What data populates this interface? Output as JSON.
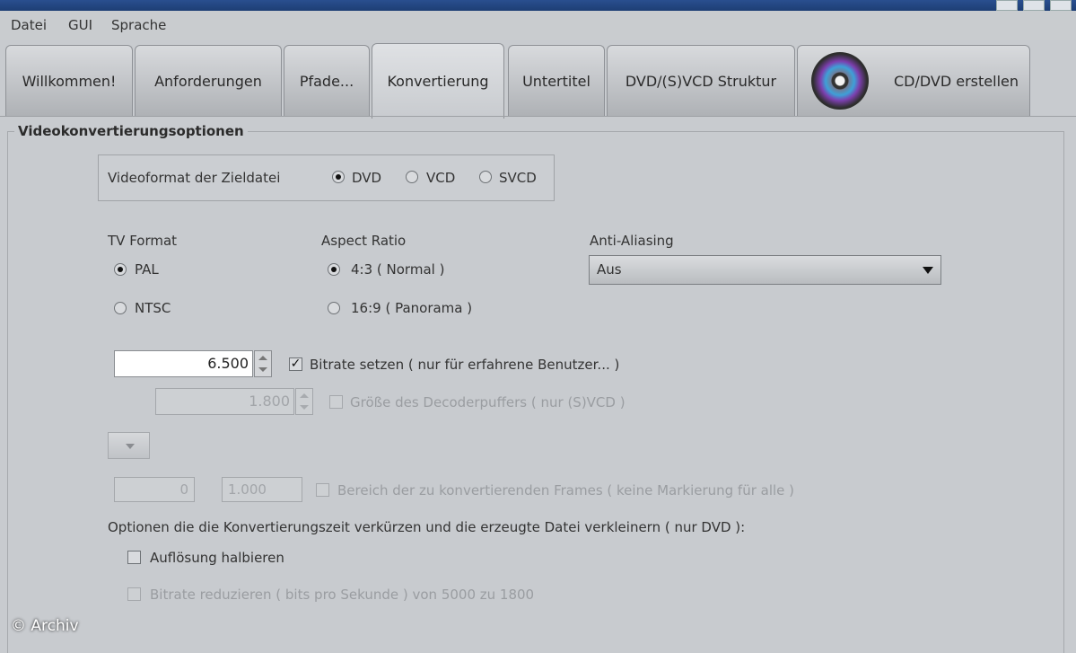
{
  "menu": {
    "items": [
      "Datei",
      "GUI",
      "Sprache"
    ]
  },
  "tabs": [
    {
      "label": "Willkommen!"
    },
    {
      "label": "Anforderungen"
    },
    {
      "label": "Pfade..."
    },
    {
      "label": "Konvertierung"
    },
    {
      "label": "Untertitel"
    },
    {
      "label": "DVD/(S)VCD Struktur"
    },
    {
      "label": "CD/DVD erstellen"
    }
  ],
  "active_tab": "Konvertierung",
  "section": {
    "title": "Videokonvertierungsoptionen"
  },
  "video_format": {
    "label": "Videoformat der Zieldatei",
    "options": [
      "DVD",
      "VCD",
      "SVCD"
    ],
    "selected": "DVD"
  },
  "tv_format": {
    "label": "TV Format",
    "options": [
      "PAL",
      "NTSC"
    ],
    "selected": "PAL"
  },
  "aspect_ratio": {
    "label": "Aspect Ratio",
    "options": [
      "4:3 ( Normal )",
      "16:9 ( Panorama )"
    ],
    "selected": "4:3 ( Normal )"
  },
  "anti_aliasing": {
    "label": "Anti-Aliasing",
    "value": "Aus"
  },
  "bitrate": {
    "value": "6.500",
    "label": "Bitrate setzen ( nur für erfahrene Benutzer... )",
    "checked": true
  },
  "decoder_buffer": {
    "value": "1.800",
    "label": "Größe des Decoderpuffers ( nur (S)VCD )"
  },
  "frame_range": {
    "from": "0",
    "to": "1.000",
    "label": "Bereich der zu konvertierenden Frames ( keine Markierung für alle )"
  },
  "options_note": "Optionen die die Konvertierungszeit verkürzen und die erzeugte Datei verkleinern ( nur DVD ):",
  "halve_resolution": {
    "label": "Auflösung halbieren"
  },
  "reduce_bitrate": {
    "label": "Bitrate reduzieren ( bits pro Sekunde ) von 5000 zu 1800"
  },
  "watermark": "© Archiv",
  "icons": {
    "disc": "cd-dvd-disc-icon"
  }
}
